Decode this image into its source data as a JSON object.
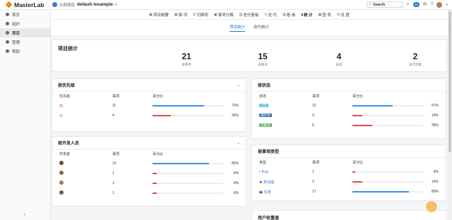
{
  "brand": {
    "name": "MasterLab"
  },
  "breadcrumb": {
    "org": "示例项目",
    "project": "default /example"
  },
  "topbar": {
    "search_label": "Search",
    "notify_count": "15"
  },
  "sidebar": {
    "items": [
      {
        "label": "首页"
      },
      {
        "label": "组织"
      },
      {
        "label": "项目"
      },
      {
        "label": "管理"
      },
      {
        "label": "帮助"
      }
    ],
    "collapse": "‹"
  },
  "project_nav": {
    "items": [
      {
        "icon": "▣",
        "label": "项目概要"
      },
      {
        "icon": "▦",
        "label": "事 项"
      },
      {
        "icon": "⇵",
        "label": "切换视"
      },
      {
        "icon": "▣",
        "label": "事项分解"
      },
      {
        "icon": "▥",
        "label": "迭代看板"
      },
      {
        "icon": "↻",
        "label": "迭 代"
      },
      {
        "icon": "▤",
        "label": "看 板"
      },
      {
        "icon": "▮",
        "label": "统 计"
      },
      {
        "icon": "▦",
        "label": "图 表"
      },
      {
        "icon": "⚙",
        "label": "设 置"
      }
    ]
  },
  "subtabs": [
    {
      "label": "项目统计"
    },
    {
      "label": "迭代统计"
    }
  ],
  "summary": {
    "title": "项目统计",
    "stats": [
      {
        "value": "21",
        "label": "总事项"
      },
      {
        "value": "15",
        "label": "未解决"
      },
      {
        "value": "4",
        "label": "关闭"
      },
      {
        "value": "2",
        "label": "迭代次数"
      }
    ]
  },
  "priority": {
    "title": "按优先级",
    "headers": [
      "优先级",
      "事项",
      "百分比"
    ],
    "rows": [
      {
        "name": "高",
        "color": "#d9534f",
        "count": "11",
        "pct": "73%",
        "fill": 0.73,
        "bar": "#3a8ee6"
      },
      {
        "name": "中",
        "color": "#5cb85c",
        "count": "4",
        "pct": "26%",
        "fill": 0.26,
        "bar": "#e04a4a"
      }
    ]
  },
  "reporter": {
    "title": "按开发人员",
    "headers": [
      "开发者",
      "事项",
      "百分比"
    ],
    "rows": [
      {
        "avatar": "#6b4a2b",
        "count": "12",
        "pct": "80%",
        "fill": 0.8,
        "bar": "#3a8ee6"
      },
      {
        "avatar": "#8a6a3a",
        "count": "1",
        "pct": "6%",
        "fill": 0.06,
        "bar": "#e04a4a"
      },
      {
        "avatar": "#a07a50",
        "count": "1",
        "pct": "6%",
        "fill": 0.06,
        "bar": "#e04a4a"
      },
      {
        "avatar": "#7a5a3a",
        "count": "1",
        "pct": "6%",
        "fill": 0.06,
        "bar": "#e04a4a"
      }
    ]
  },
  "status": {
    "title": "按状态",
    "headers": [
      "状态",
      "事项",
      "百分比"
    ],
    "rows": [
      {
        "name": "打开",
        "color": "#5bc0de",
        "count": "12",
        "pct": "57%",
        "fill": 0.57,
        "bar": "#3a8ee6"
      },
      {
        "name": "进行中",
        "color": "#337ab7",
        "count": "3",
        "pct": "14%",
        "fill": 0.14,
        "bar": "#e04a4a"
      },
      {
        "name": "已解决",
        "color": "#5cb85c",
        "count": "6",
        "pct": "28%",
        "fill": 0.28,
        "bar": "#e04a4a"
      }
    ]
  },
  "issue_type": {
    "title": "按事项类型",
    "headers": [
      "类型",
      "事项",
      "百分比"
    ],
    "rows": [
      {
        "icon": "▪",
        "name": "Bug",
        "count": "1",
        "pct": "4%",
        "fill": 0.04,
        "bar": "#e04a4a"
      },
      {
        "icon": "✚",
        "name": "新功能",
        "count": "3",
        "pct": "14%",
        "fill": 0.14,
        "bar": "#e04a4a"
      },
      {
        "icon": "▣",
        "name": "任务",
        "count": "17",
        "pct": "80%",
        "fill": 0.8,
        "bar": "#3a8ee6"
      }
    ]
  },
  "user_panel": {
    "title": "用户权重值"
  }
}
